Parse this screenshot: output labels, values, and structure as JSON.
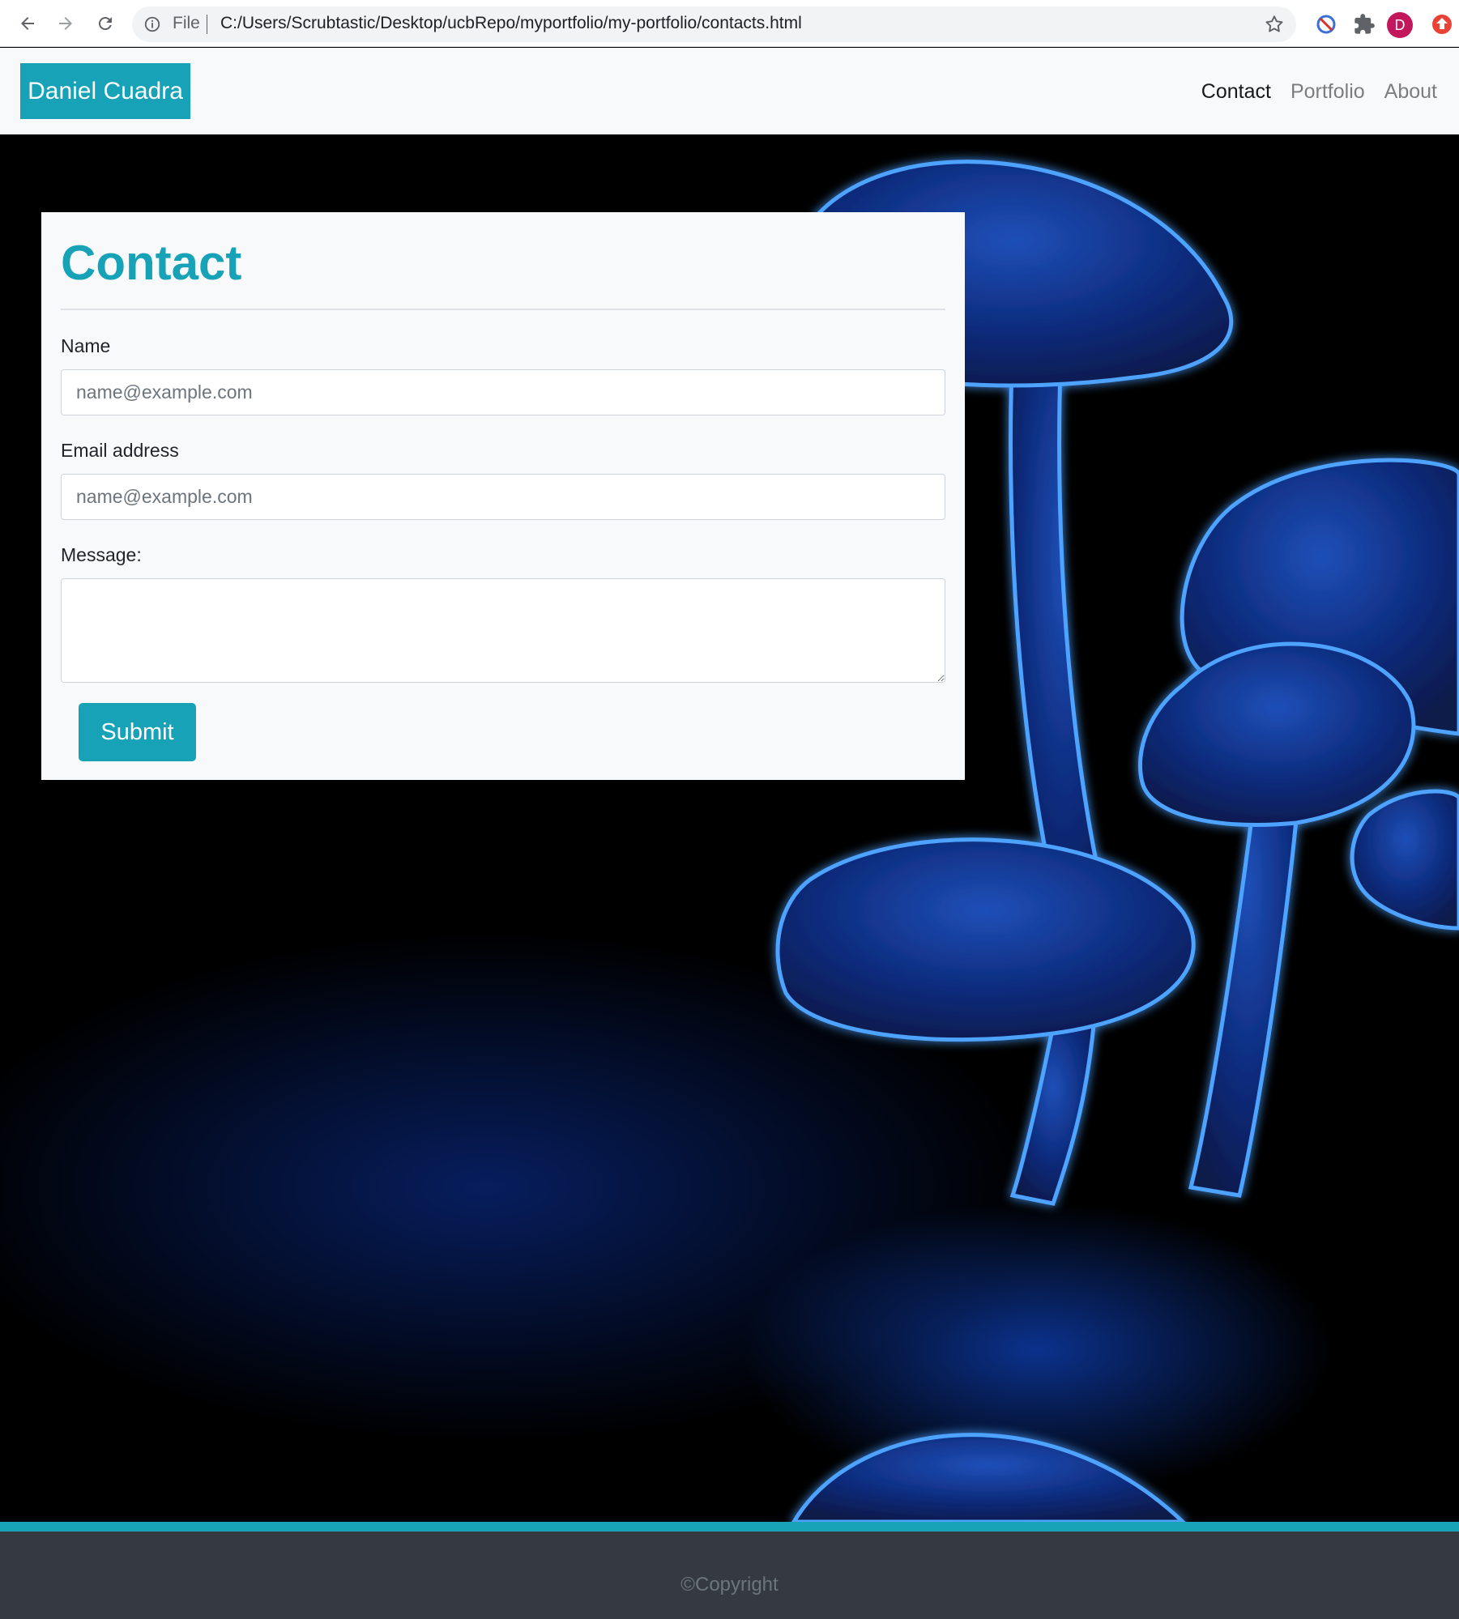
{
  "browser": {
    "scheme_label": "File",
    "url": "C:/Users/Scrubtastic/Desktop/ucbRepo/myportfolio/my-portfolio/contacts.html",
    "profile_initial": "D"
  },
  "navbar": {
    "brand": "Daniel Cuadra",
    "links": [
      "Contact",
      "Portfolio",
      "About"
    ],
    "active_link": "Contact"
  },
  "contact_form": {
    "title": "Contact",
    "name_label": "Name",
    "name_placeholder": "name@example.com",
    "email_label": "Email address",
    "email_placeholder": "name@example.com",
    "message_label": "Message:",
    "submit_label": "Submit"
  },
  "footer": {
    "copyright": "©Copyright"
  },
  "colors": {
    "accent": "#17a2b8",
    "navbar_bg": "#f8f9fa",
    "footer_bg": "#343a40"
  }
}
